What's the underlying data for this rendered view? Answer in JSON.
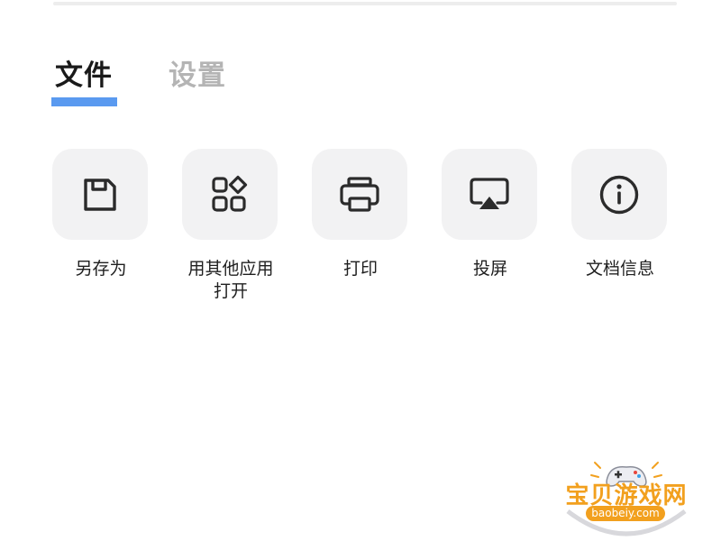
{
  "tabs": [
    {
      "label": "文件",
      "active": true
    },
    {
      "label": "设置",
      "active": false
    }
  ],
  "actions": [
    {
      "label": "另存为",
      "icon": "save-icon"
    },
    {
      "label": "用其他应用\n打开",
      "icon": "apps-icon"
    },
    {
      "label": "打印",
      "icon": "printer-icon"
    },
    {
      "label": "投屏",
      "icon": "cast-screen-icon"
    },
    {
      "label": "文档信息",
      "icon": "info-icon"
    }
  ],
  "watermark": {
    "title": "宝贝游戏网",
    "url": "baobeiy.com"
  },
  "colors": {
    "tab_active": "#1a1a1a",
    "tab_inactive": "#b4b4b4",
    "tab_indicator": "#5a9af0",
    "tile_background": "#f2f2f3",
    "watermark_orange": "#f2a01e"
  }
}
